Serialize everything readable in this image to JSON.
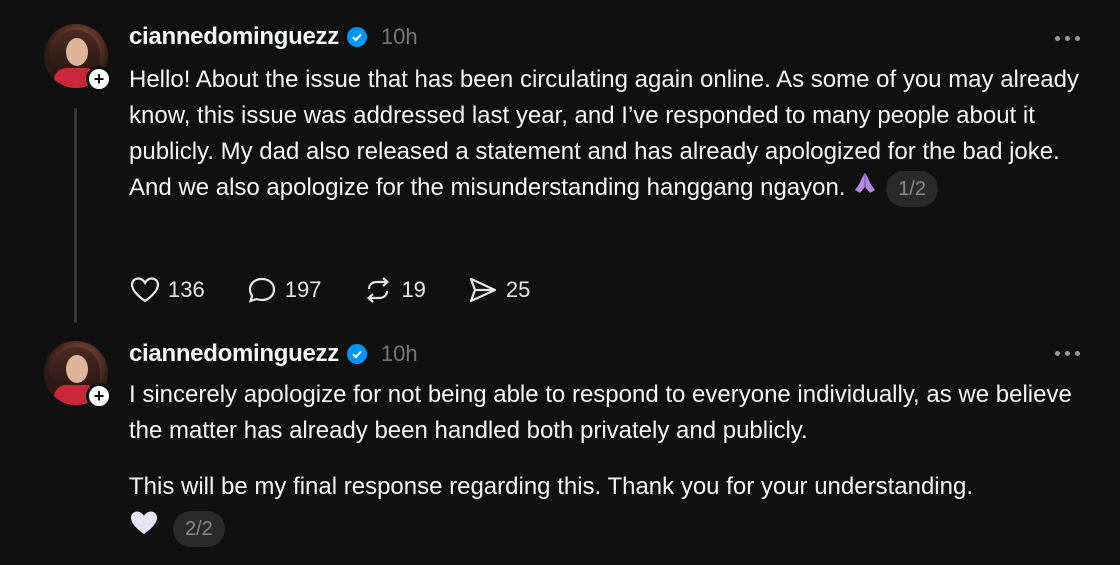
{
  "posts": [
    {
      "username": "ciannedominguezz",
      "time": "10h",
      "paragraphs": [
        "Hello! About the issue that has been circulating again online. As some of you may already know, this issue was addressed last year, and I’ve responded to many people about it publicly. My dad also released a statement and has already apologized for the bad joke. And we also apologize for the misunderstanding hanggang ngayon."
      ],
      "emoji": "praying-hands-icon",
      "page": "1/2",
      "stats": {
        "likes": "136",
        "replies": "197",
        "reposts": "19",
        "shares": "25"
      }
    },
    {
      "username": "ciannedominguezz",
      "time": "10h",
      "paragraphs": [
        "I sincerely apologize for not being able to respond to everyone individually, as we believe the matter has already been handled both privately and publicly.",
        "This will be my final response regarding this. Thank you for your understanding."
      ],
      "emoji": "white-heart-icon",
      "page": "2/2"
    }
  ],
  "colors": {
    "background": "#101010",
    "text": "#f3f5f7",
    "muted": "#777777",
    "verified": "#0095f6"
  }
}
